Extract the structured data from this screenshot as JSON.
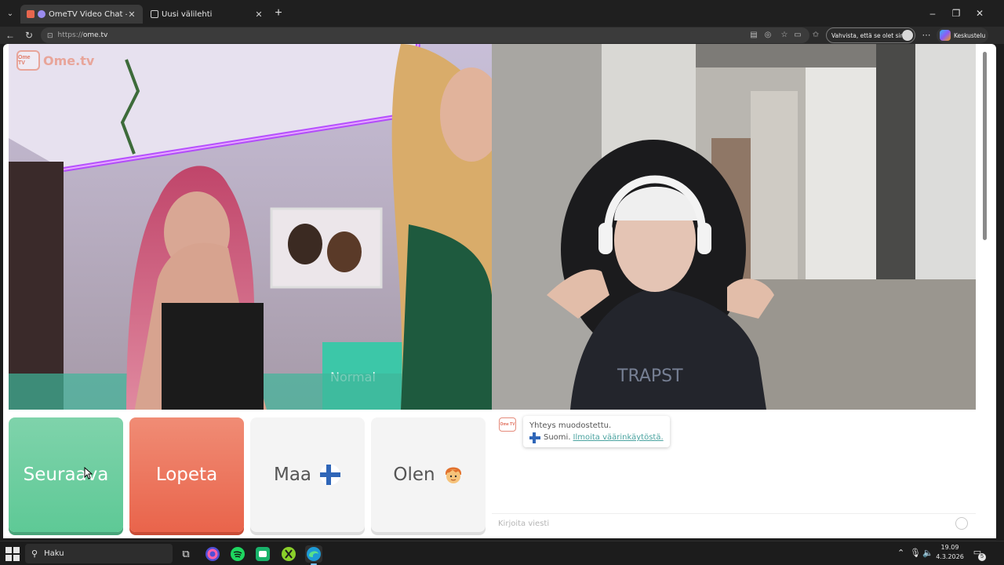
{
  "browser": {
    "tabs": [
      {
        "title": "OmeTV Video Chat — Omegle",
        "active": true
      },
      {
        "title": "Uusi välilehti",
        "active": false
      }
    ],
    "url_scheme": "https://",
    "url_host": "ome.tv",
    "verify_label": "Vahvista, että se olet sinä",
    "copilot_label": "Keskustelu"
  },
  "site": {
    "logo_icon_text": "Ome TV",
    "logo_text": "Ome.tv"
  },
  "controls": {
    "next_label": "Seuraava",
    "stop_label": "Lopeta",
    "country_label": "Maa",
    "gender_label": "Olen"
  },
  "chat": {
    "status_text": "Yhteys muodostettu.",
    "country_text": "Suomi.",
    "report_link": "Ilmoita väärinkäytöstä.",
    "input_placeholder": "Kirjoita viesti"
  },
  "taskbar": {
    "search_label": "Haku",
    "time": "19.09",
    "date": "4.3.2026",
    "notification_count": "5"
  },
  "colors": {
    "next": "#5ec996",
    "stop": "#e9644b",
    "brand": "#e8a59a",
    "link": "#4aa3a0"
  }
}
